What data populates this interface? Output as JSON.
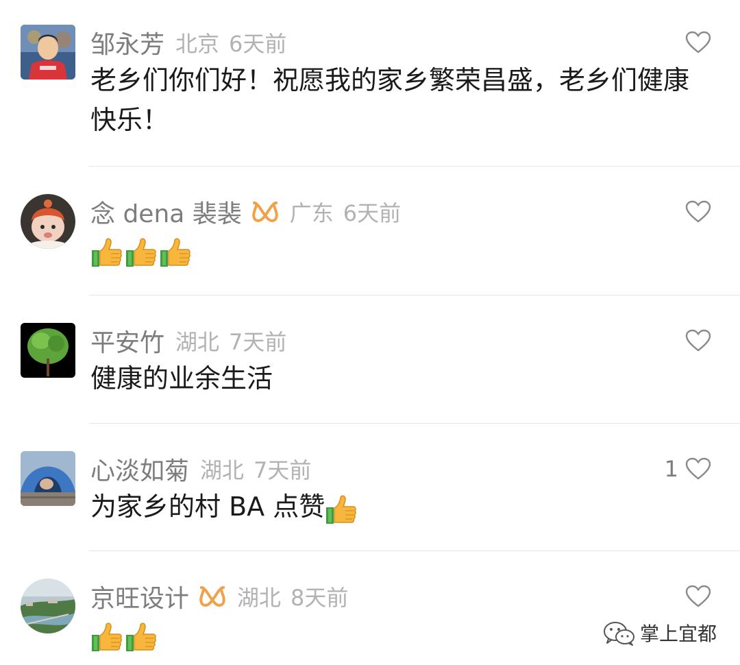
{
  "comments": [
    {
      "name": "邹永芳",
      "location": "北京",
      "time": "6天前",
      "text": "老乡们你们好！祝愿我的家乡繁荣昌盛，老乡们健康快乐！",
      "likes": "",
      "verified": false
    },
    {
      "name": "念 dena 裴裴",
      "location": "广东",
      "time": "6天前",
      "text": "",
      "thumbs": 3,
      "likes": "",
      "verified": true
    },
    {
      "name": "平安竹",
      "location": "湖北",
      "time": "7天前",
      "text": "健康的业余生活",
      "likes": "",
      "verified": false
    },
    {
      "name": "心淡如菊",
      "location": "湖北",
      "time": "7天前",
      "text": "为家乡的村 BA 点赞",
      "thumbs": 1,
      "likes": "1",
      "verified": false
    },
    {
      "name": "京旺设计",
      "location": "湖北",
      "time": "8天前",
      "text": "",
      "thumbs": 2,
      "likes": "",
      "verified": true
    }
  ],
  "icons": {
    "like": "heart-outline-icon",
    "verified": "orange-badge-icon",
    "thumb": "thumbs-up-emoji-icon",
    "watermark": "wechat-icon"
  },
  "colors": {
    "name": "#7d7d7d",
    "meta": "#b2b2b2",
    "text": "#1a1a1a",
    "badge": "#f0a24a",
    "divider": "#e5e5e5"
  },
  "watermark": {
    "text": "掌上宜都"
  }
}
